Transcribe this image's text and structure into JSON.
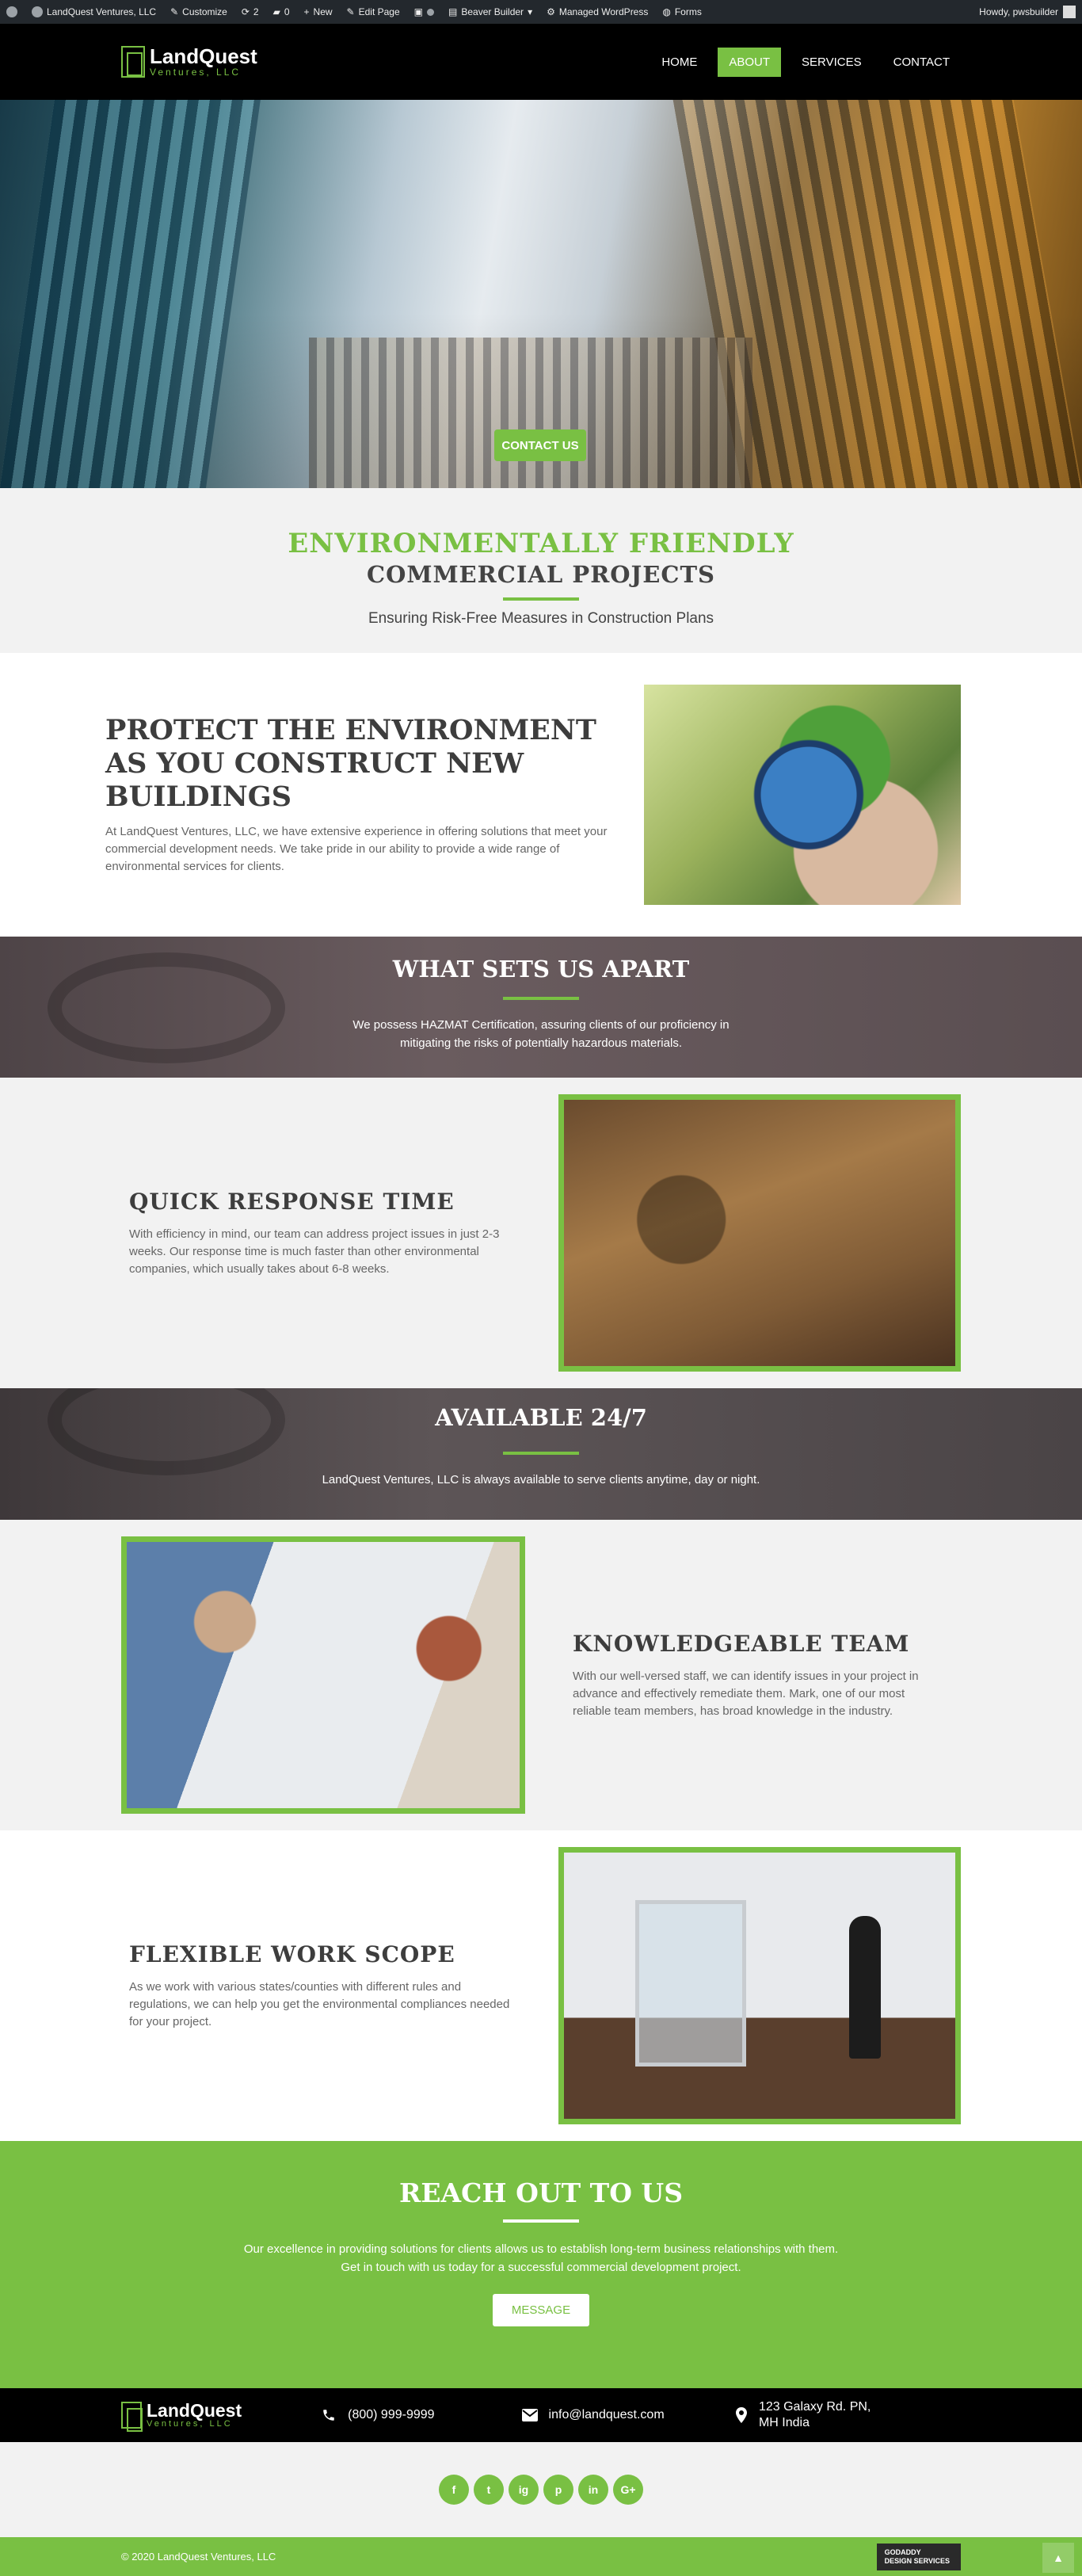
{
  "admin_bar": {
    "site_name": "LandQuest Ventures, LLC",
    "customize": "Customize",
    "updates_count": "2",
    "comments_count": "0",
    "new": "New",
    "edit_page": "Edit Page",
    "beaver_builder": "Beaver Builder",
    "managed_wordpress": "Managed WordPress",
    "forms": "Forms",
    "howdy": "Howdy, pwsbuilder"
  },
  "header": {
    "logo_line1": "LandQuest",
    "logo_line2": "Ventures, LLC",
    "nav": [
      "HOME",
      "ABOUT",
      "SERVICES",
      "CONTACT"
    ]
  },
  "hero": {
    "cta": "CONTACT US"
  },
  "eco": {
    "title1": "ENVIRONMENTALLY FRIENDLY",
    "title2": "COMMERCIAL PROJECTS",
    "subtitle": "Ensuring Risk-Free Measures in Construction Plans"
  },
  "protect": {
    "heading": "PROTECT THE ENVIRONMENT AS YOU CONSTRUCT NEW BUILDINGS",
    "body": "At LandQuest Ventures, LLC, we have extensive experience in offering solutions that meet your commercial development needs. We take pride in our ability to provide a wide range of environmental services for clients."
  },
  "apart": {
    "heading": "WHAT SETS US APART",
    "body": "We possess HAZMAT Certification, assuring clients of our proficiency in mitigating the risks of potentially hazardous materials."
  },
  "quick": {
    "heading": "QUICK RESPONSE TIME",
    "body": "With efficiency in mind, our team can address project issues in just 2-3 weeks. Our response time is much faster than other environmental companies, which usually takes about 6-8 weeks."
  },
  "available": {
    "heading": "AVAILABLE 24/7",
    "body": "LandQuest Ventures, LLC is always available to serve clients anytime, day or night."
  },
  "team": {
    "heading": "KNOWLEDGEABLE TEAM",
    "body": "With our well-versed staff, we can identify issues in your project in advance and effectively remediate them. Mark, one of our most reliable team members, has broad knowledge in the industry."
  },
  "flex": {
    "heading": "FLEXIBLE WORK SCOPE",
    "body": "As we work with various states/counties with different rules and regulations, we can help you get the environmental compliances needed for your project."
  },
  "reach": {
    "heading": "REACH OUT TO US",
    "line1": "Our excellence in providing solutions for clients allows us to establish long-term business relationships with them.",
    "line2": "Get in touch with us today for a successful commercial development project.",
    "button": "MESSAGE"
  },
  "contact": {
    "phone": "(800) 999-9999",
    "email": "info@landquest.com",
    "address": "123 Galaxy Rd. PN, MH India"
  },
  "social": [
    "f",
    "t",
    "ig",
    "p",
    "in",
    "G+"
  ],
  "footer": {
    "copyright": "© 2020 LandQuest Ventures, LLC",
    "badge_line1": "GODADDY",
    "badge_line2": "DESIGN SERVICES"
  },
  "colors": {
    "accent": "#79c043",
    "dark": "#000000",
    "admin_bar": "#23282d"
  }
}
